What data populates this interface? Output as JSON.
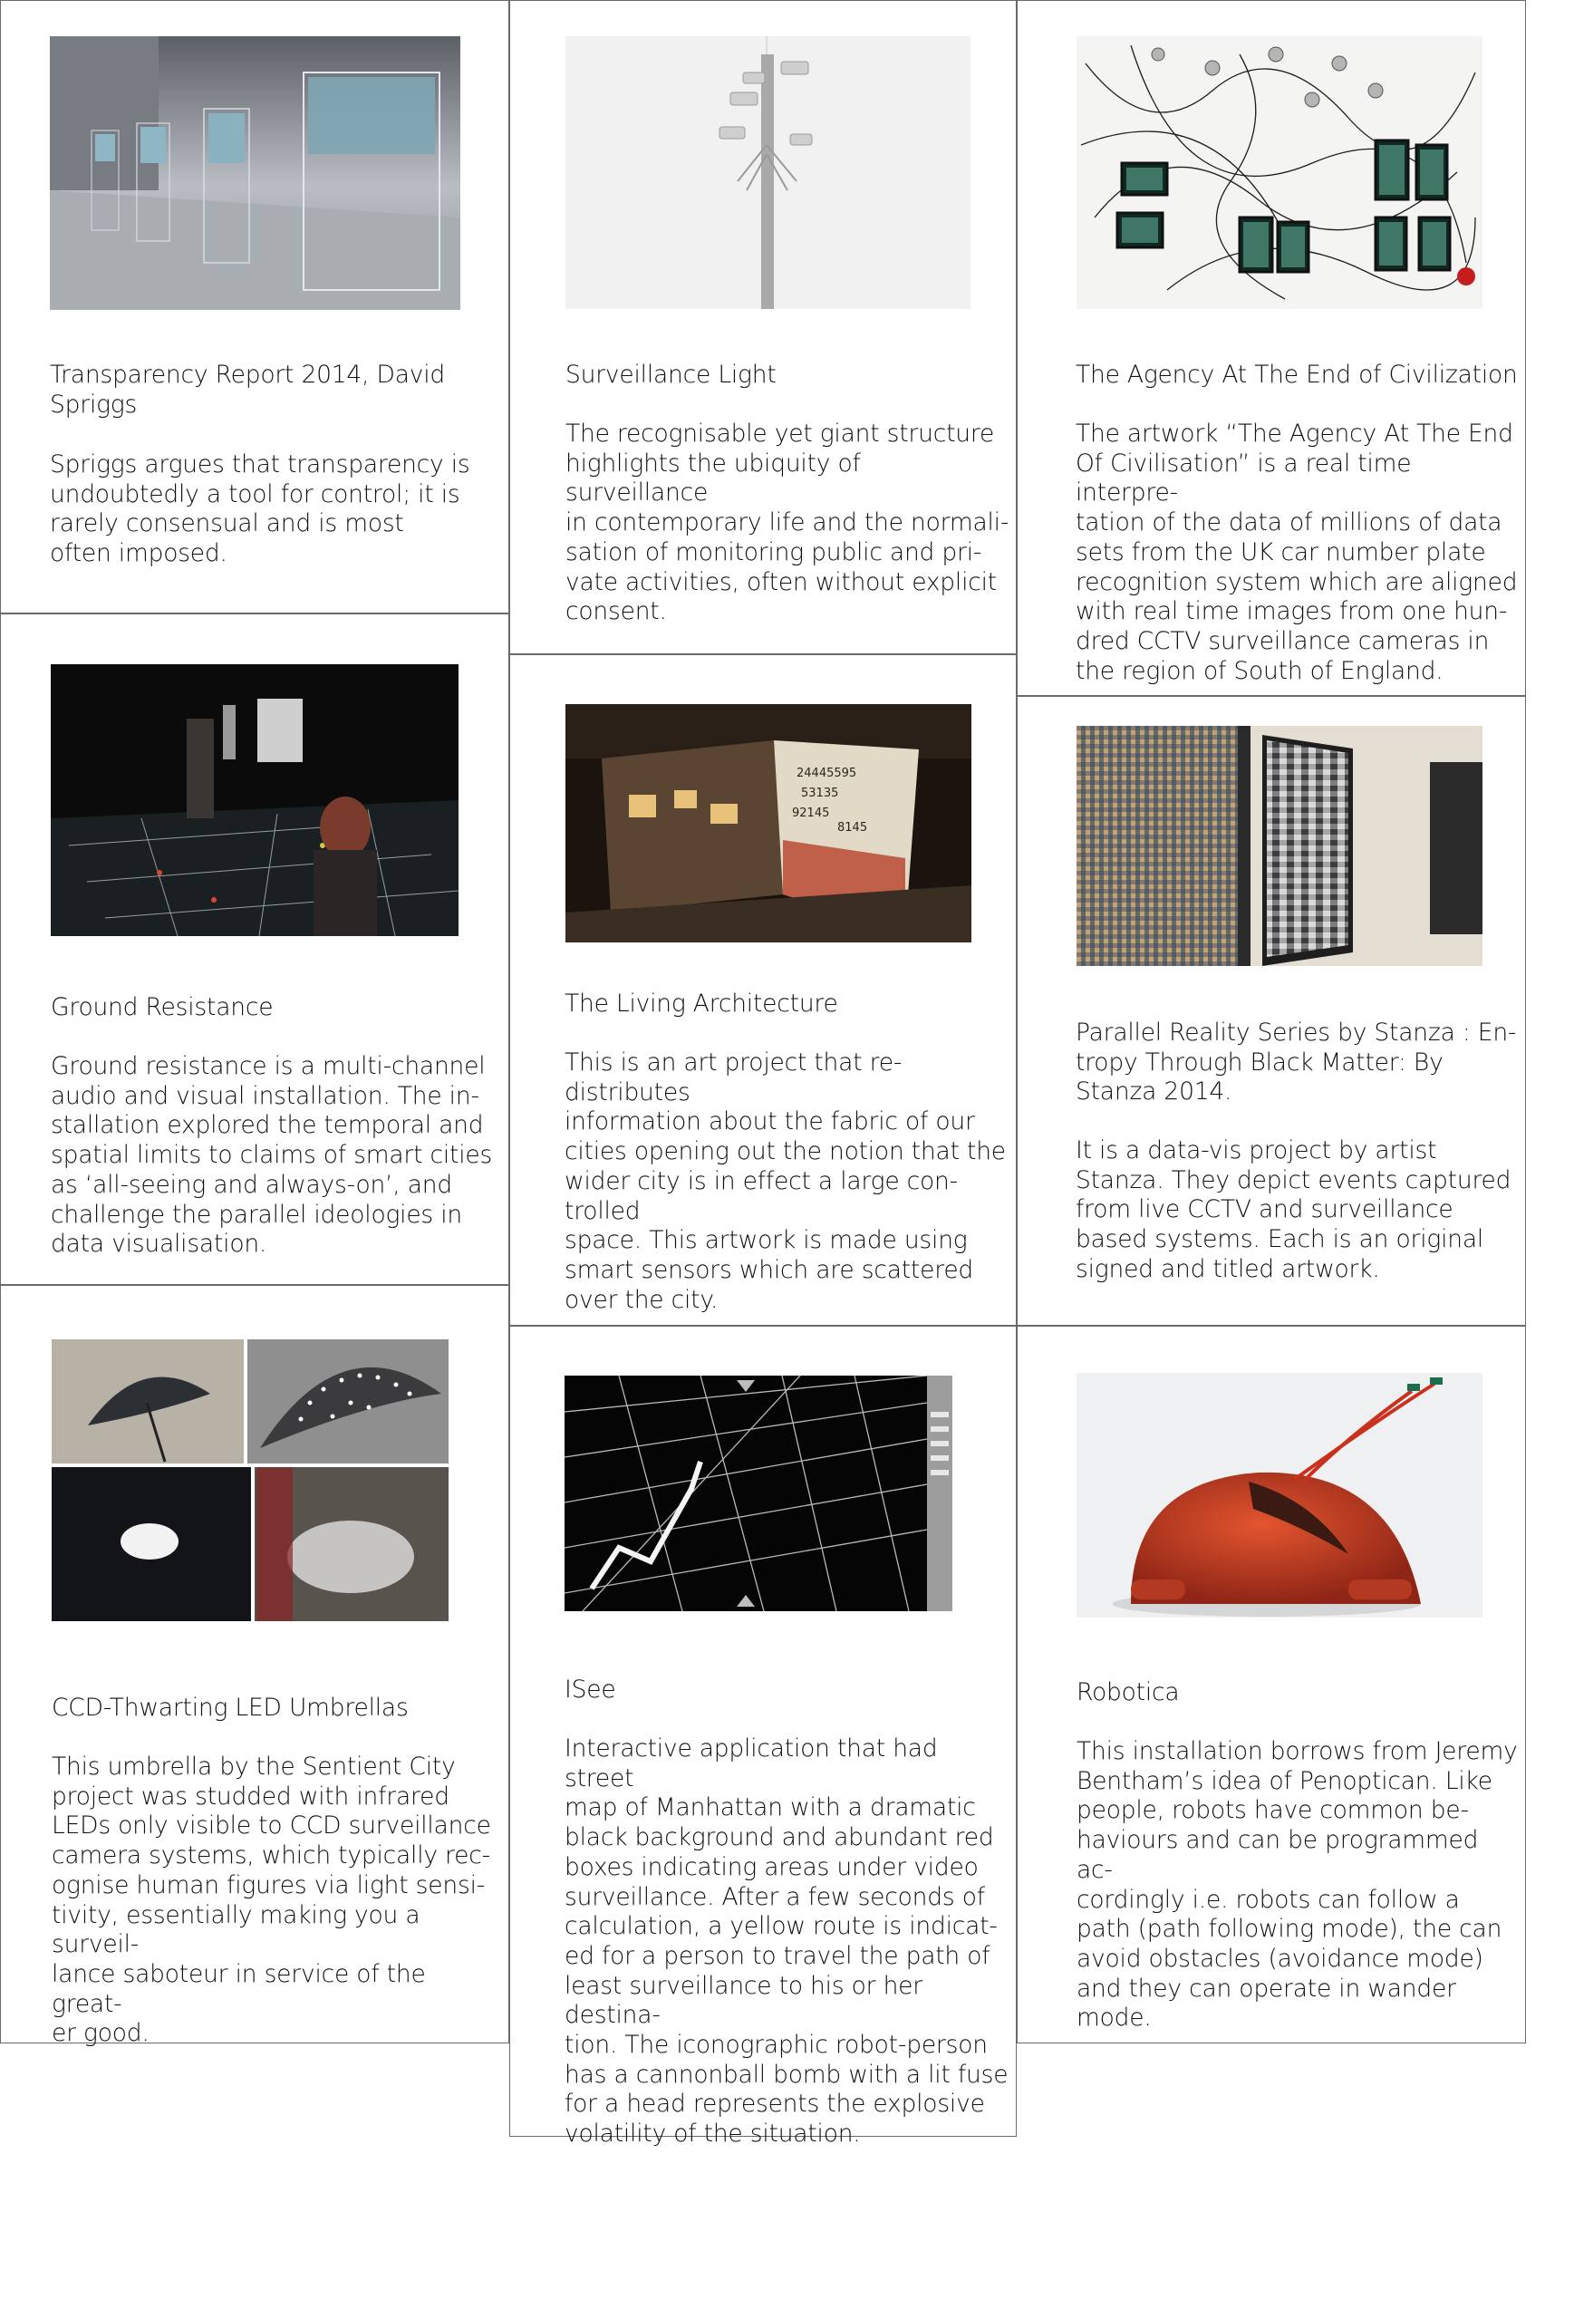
{
  "cards": [
    {
      "title": "Transparency Report 2014, David\nSpriggs",
      "image": "glass-cases-gallery-image",
      "desc": "Spriggs argues that transparency is\nundoubtedly a tool for control; it is\nrarely consensual and is most\noften imposed."
    },
    {
      "title": "Surveillance Light",
      "image": "cctv-pole-image",
      "desc": "The recognisable yet giant structure\nhighlights the ubiquity of surveillance\nin contemporary life and the normali-\nsation of monitoring public and pri-\nvate activities, often without explicit\nconsent."
    },
    {
      "title": "The Agency At The End of Civilization",
      "image": "cameras-and-monitors-wall-image",
      "desc": "The artwork “The Agency At The End\nOf Civilisation” is a real time interpre-\ntation of the data of millions of data\nsets from the UK car number plate\nrecognition system which are aligned\nwith real time images from one hun-\ndred CCTV surveillance cameras in\nthe region of South of England."
    },
    {
      "title": "Ground Resistance",
      "image": "dark-map-floor-installation-image",
      "desc": "Ground resistance is a multi-channel\naudio and visual installation. The in-\nstallation explored the temporal and\nspatial limits to claims of smart cities\nas ‘all-seeing and always-on’, and\nchallenge the parallel ideologies in\ndata visualisation."
    },
    {
      "title": "The Living Architecture",
      "image": "projected-numbers-building-image",
      "desc": "This is an art project that re-distributes\ninformation about the fabric of our\ncities opening out the notion that the\nwider city is in effect a large con-\ntrolled\nspace. This artwork is made using\nsmart sensors which are scattered\nover the city."
    },
    {
      "title": "Parallel Reality Series by Stanza : En-\ntropy Through Black Matter: By\nStanza 2014.",
      "image": "mosaic-screens-gallery-image",
      "desc": "It is a data-vis project by artist\nStanza. They depict events captured\nfrom live CCTV and surveillance\nbased systems. Each is an original\nsigned and titled artwork."
    },
    {
      "title": "CCD-Thwarting LED Umbrellas",
      "image": "led-umbrellas-collage-image",
      "desc": "This umbrella by the Sentient City\nproject was studded with infrared\nLEDs only visible to CCD surveillance\ncamera systems, which typically rec-\nognise human figures via light sensi-\ntivity, essentially making you a surveil-\nlance saboteur in service of the great-\ner good."
    },
    {
      "title": "ISee",
      "image": "manhattan-street-map-image",
      "desc": "Interactive application that had street\nmap of Manhattan with a dramatic\nblack background and abundant red\nboxes indicating areas under video\nsurveillance. After a few seconds of\ncalculation, a yellow route is indicat-\ned for a person to travel the path of\nleast surveillance to his or her destina-\ntion. The iconographic robot-person\nhas a cannonball bomb with a lit fuse\nfor a head represents the explosive\nvolatility of the situation."
    },
    {
      "title": "Robotica",
      "image": "red-robot-sculpture-image",
      "desc": "This installation borrows from Jeremy\nBentham’s idea of Penoptican. Like\npeople, robots have common be-\nhaviours and can be programmed ac-\ncordingly i.e. robots can follow a\npath (path following mode), the can\navoid obstacles (avoidance mode)\nand they can operate in wander\nmode."
    }
  ]
}
